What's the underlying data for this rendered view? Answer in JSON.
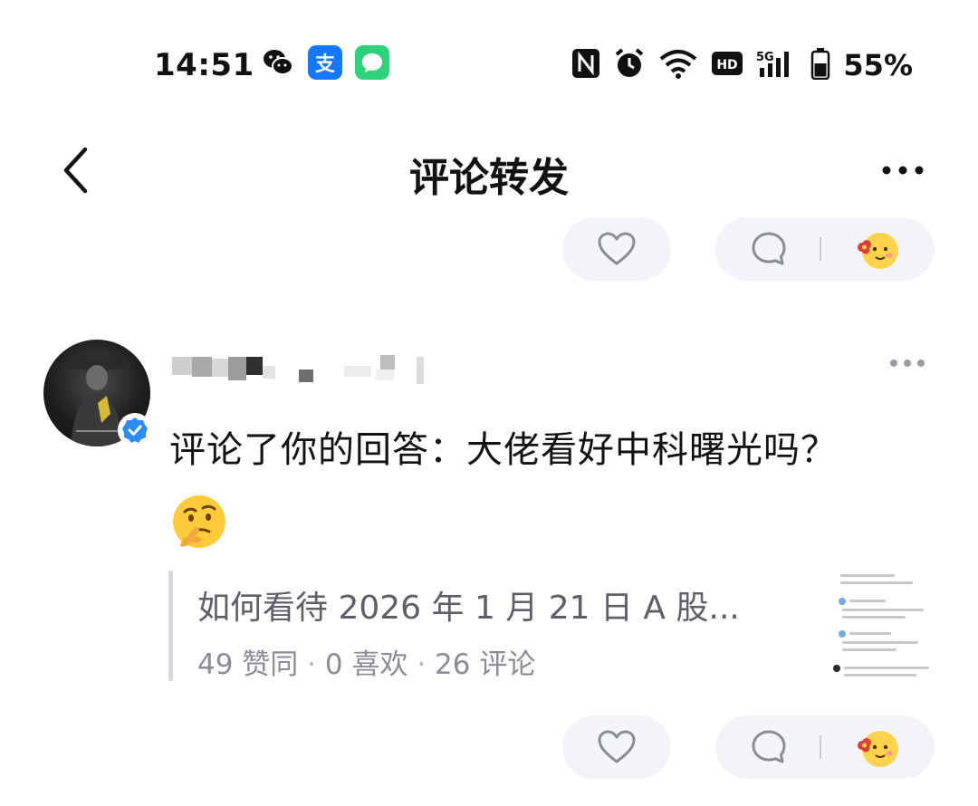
{
  "status_bar": {
    "time": "14:51",
    "battery_percent": "55%",
    "app_icons": [
      "wechat-icon",
      "alipay-icon",
      "messages-icon"
    ],
    "status_icons": [
      "nfc-icon",
      "alarm-icon",
      "wifi-icon",
      "hd-icon",
      "5g-signal-icon",
      "battery-icon"
    ],
    "alipay_label": "支"
  },
  "header": {
    "title": "评论转发"
  },
  "notification": {
    "comment": "评论了你的回答：大佬看好中科曙光吗？",
    "quote": {
      "title": "如何看待 2026 年 1 月 21 日 A 股...",
      "likes": "49 赞同",
      "favorites": "0 喜欢",
      "comments": "26 评论",
      "separator": "·"
    }
  },
  "colors": {
    "pill_bg": "#f3f4f7",
    "verified_blue": "#2e8cf0",
    "quote_bar": "#d6d8de"
  }
}
